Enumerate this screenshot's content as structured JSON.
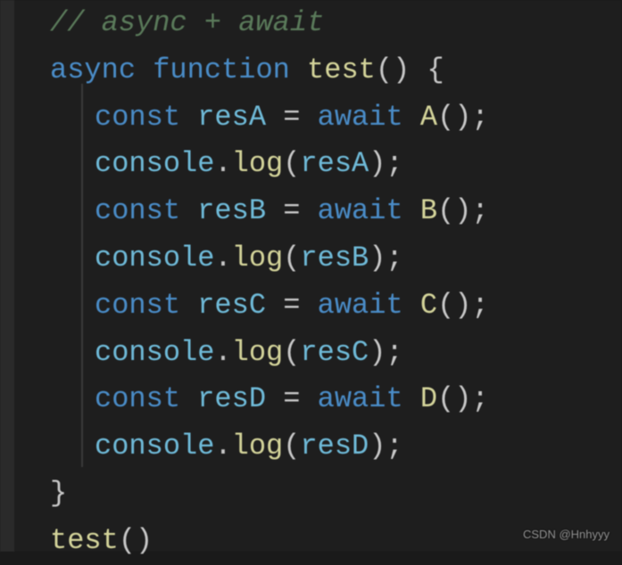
{
  "code": {
    "l1_comment": "// async + await",
    "l2_async": "async",
    "l2_function": "function",
    "l2_name": "test",
    "l2_parens": "()",
    "l2_brace": " {",
    "const_kw": "const",
    "await_kw": "await",
    "eq": " = ",
    "semi": ";",
    "open_p": "(",
    "close_p": ")",
    "dot": ".",
    "console": "console",
    "log": "log",
    "resA": "resA",
    "A": "A",
    "resB": "resB",
    "B": "B",
    "resC": "resC",
    "C": "C",
    "resD": "resD",
    "D": "D",
    "close_brace": "}",
    "call_test": "test",
    "call_parens": "()"
  },
  "watermark": "CSDN @Hnhyyy"
}
